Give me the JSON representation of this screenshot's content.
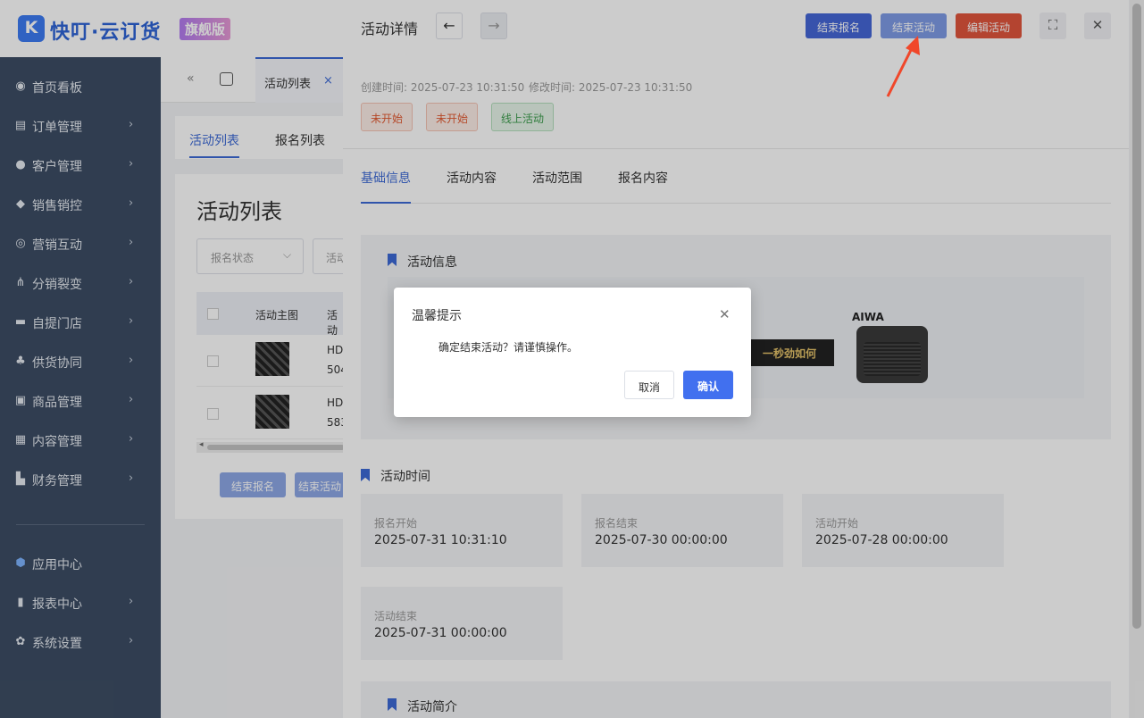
{
  "brand": {
    "name": "快叮·云订货",
    "edition": "旗舰版"
  },
  "sidebar": {
    "items": [
      {
        "label": "首页看板",
        "icon": "dashboard-icon",
        "arrow": ""
      },
      {
        "label": "订单管理",
        "icon": "order-icon",
        "arrow": "›"
      },
      {
        "label": "客户管理",
        "icon": "user-icon",
        "arrow": "›"
      },
      {
        "label": "销售销控",
        "icon": "tag-icon",
        "arrow": "›"
      },
      {
        "label": "营销互动",
        "icon": "target-icon",
        "arrow": "›"
      },
      {
        "label": "分销裂变",
        "icon": "tree-icon",
        "arrow": "›"
      },
      {
        "label": "自提门店",
        "icon": "store-icon",
        "arrow": "›"
      },
      {
        "label": "供货协同",
        "icon": "team-icon",
        "arrow": "›"
      },
      {
        "label": "商品管理",
        "icon": "goods-icon",
        "arrow": "›"
      },
      {
        "label": "内容管理",
        "icon": "document-icon",
        "arrow": "›"
      },
      {
        "label": "财务管理",
        "icon": "wallet-icon",
        "arrow": "›"
      }
    ],
    "bottom_items": [
      {
        "label": "应用中心",
        "icon": "cube-icon",
        "arrow": ""
      },
      {
        "label": "报表中心",
        "icon": "bar-chart-icon",
        "arrow": "›"
      },
      {
        "label": "系统设置",
        "icon": "gear-icon",
        "arrow": "›"
      }
    ]
  },
  "tabsbar": {
    "back": "«",
    "tab_label": "活动列表",
    "tab_close": "×"
  },
  "list": {
    "tab_active": "活动列表",
    "tab_other": "报名列表",
    "title": "活动列表",
    "filter_status": "报名状态",
    "filter_chevron": "⌵",
    "filter_second": "活动",
    "col_subject": "活动主图",
    "col_name": "活动",
    "rows": [
      {
        "line1": "HD",
        "line2": "504"
      },
      {
        "line1": "HD",
        "line2": "583"
      }
    ],
    "scroll_left": "◂",
    "btn_end_signup": "结束报名",
    "btn_end_activity": "结束活动"
  },
  "drawer": {
    "title": "活动详情",
    "prev": "←",
    "next": "→",
    "btn_end_signup": "结束报名",
    "btn_end_activity": "结束活动",
    "btn_edit": "编辑活动",
    "fullscreen": "⛶",
    "close": "✕",
    "created": "创建时间: 2025-07-23 10:31:50",
    "modified": "修改时间: 2025-07-23 10:31:50",
    "tags": [
      "未开始",
      "未开始",
      "线上活动"
    ],
    "tabs": [
      "基础信息",
      "活动内容",
      "活动范围",
      "报名内容"
    ],
    "section_info": "活动信息",
    "banner_text": "一秒劲如何",
    "banner_brand": "AIWA",
    "section_time": "活动时间",
    "times": [
      {
        "label": "报名开始",
        "value": "2025-07-31 10:31:10"
      },
      {
        "label": "报名结束",
        "value": "2025-07-30 00:00:00"
      },
      {
        "label": "活动开始",
        "value": "2025-07-28 00:00:00"
      },
      {
        "label": "活动结束",
        "value": "2025-07-31 00:00:00"
      }
    ],
    "section_intro": "活动简介"
  },
  "dialog": {
    "title": "温馨提示",
    "close": "✕",
    "message": "确定结束活动？请谨慎操作。",
    "cancel": "取消",
    "confirm": "确认"
  },
  "colors": {
    "primary": "#3d6ad6",
    "sidebar": "#3d4d64",
    "danger": "#e2553d",
    "annotation": "#f0472a"
  }
}
